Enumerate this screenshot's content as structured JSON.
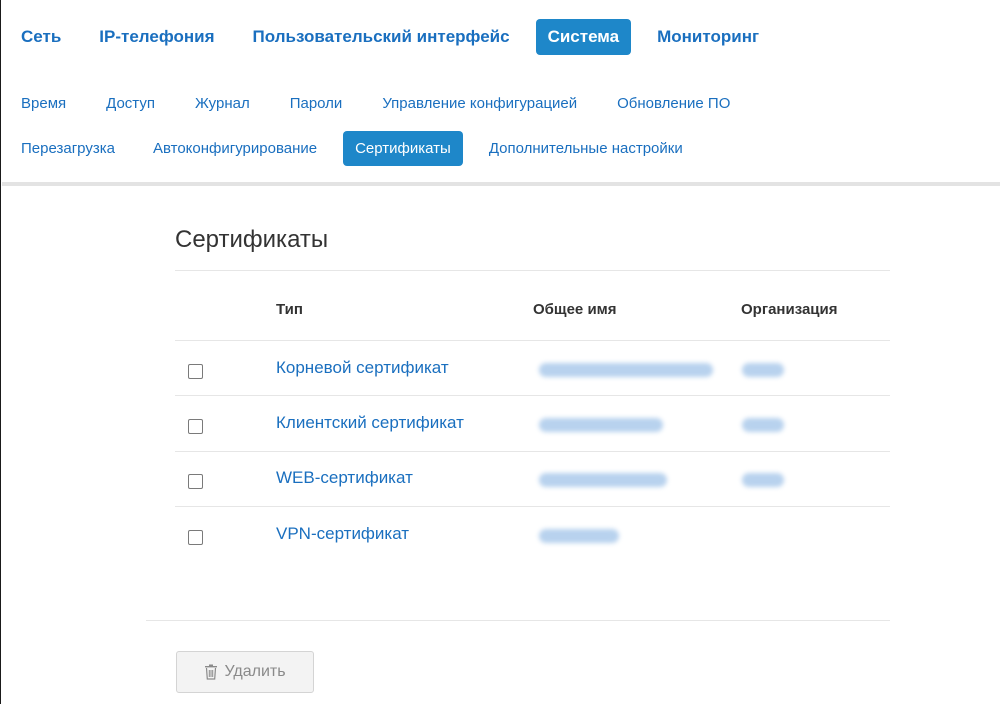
{
  "top_nav": {
    "items": [
      {
        "label": "Сеть",
        "active": false
      },
      {
        "label": "IP-телефония",
        "active": false
      },
      {
        "label": "Пользовательский интерфейс",
        "active": false
      },
      {
        "label": "Система",
        "active": true
      },
      {
        "label": "Мониторинг",
        "active": false
      }
    ]
  },
  "sub_nav": {
    "row1": [
      "Время",
      "Доступ",
      "Журнал",
      "Пароли",
      "Управление конфигурацией",
      "Обновление ПО"
    ],
    "row2": [
      "Перезагрузка",
      "Автоконфигурирование",
      "Сертификаты",
      "Дополнительные настройки"
    ],
    "active": "Сертификаты"
  },
  "page": {
    "title": "Сертификаты",
    "columns": {
      "type": "Тип",
      "common_name": "Общее имя",
      "organization": "Организация"
    },
    "rows": [
      {
        "type": "Корневой сертификат",
        "common_name_redacted": true,
        "organization_redacted": true
      },
      {
        "type": "Клиентский сертификат",
        "common_name_redacted": true,
        "organization_redacted": true
      },
      {
        "type": "WEB-сертификат",
        "common_name_redacted": true,
        "organization_redacted": true
      },
      {
        "type": "VPN-сертификат",
        "common_name_redacted": true,
        "organization_redacted": false
      }
    ],
    "delete_button": "Удалить"
  },
  "colors": {
    "accent": "#1e87c9",
    "link": "#1a6fbf",
    "redacted": "#b8d2ee"
  }
}
